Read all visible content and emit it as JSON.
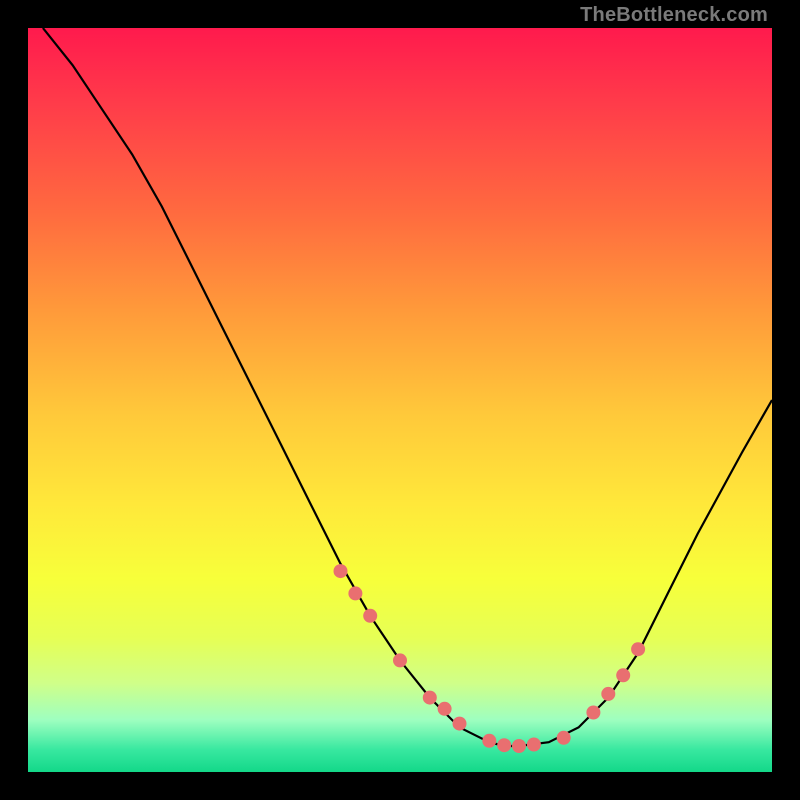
{
  "attribution": "TheBottleneck.com",
  "chart_data": {
    "type": "line",
    "title": "",
    "xlabel": "",
    "ylabel": "",
    "xlim": [
      0,
      100
    ],
    "ylim": [
      0,
      100
    ],
    "grid": false,
    "legend": false,
    "series": [
      {
        "name": "curve",
        "x": [
          2,
          6,
          10,
          14,
          18,
          22,
          26,
          30,
          34,
          38,
          42,
          46,
          50,
          54,
          58,
          60,
          62,
          64,
          66,
          70,
          74,
          78,
          82,
          86,
          90,
          96,
          100
        ],
        "y": [
          100,
          95,
          89,
          83,
          76,
          68,
          60,
          52,
          44,
          36,
          28,
          21,
          15,
          10,
          6,
          5,
          4,
          3.5,
          3.5,
          4,
          6,
          10,
          16,
          24,
          32,
          43,
          50
        ]
      }
    ],
    "markers": {
      "name": "dots",
      "color": "#e96f70",
      "radius_px": 7,
      "x": [
        42,
        44,
        46,
        50,
        54,
        56,
        58,
        62,
        64,
        66,
        68,
        72,
        76,
        78,
        80,
        82
      ],
      "y": [
        27,
        24,
        21,
        15,
        10,
        8.5,
        6.5,
        4.2,
        3.6,
        3.5,
        3.7,
        4.6,
        8,
        10.5,
        13,
        16.5
      ]
    }
  }
}
